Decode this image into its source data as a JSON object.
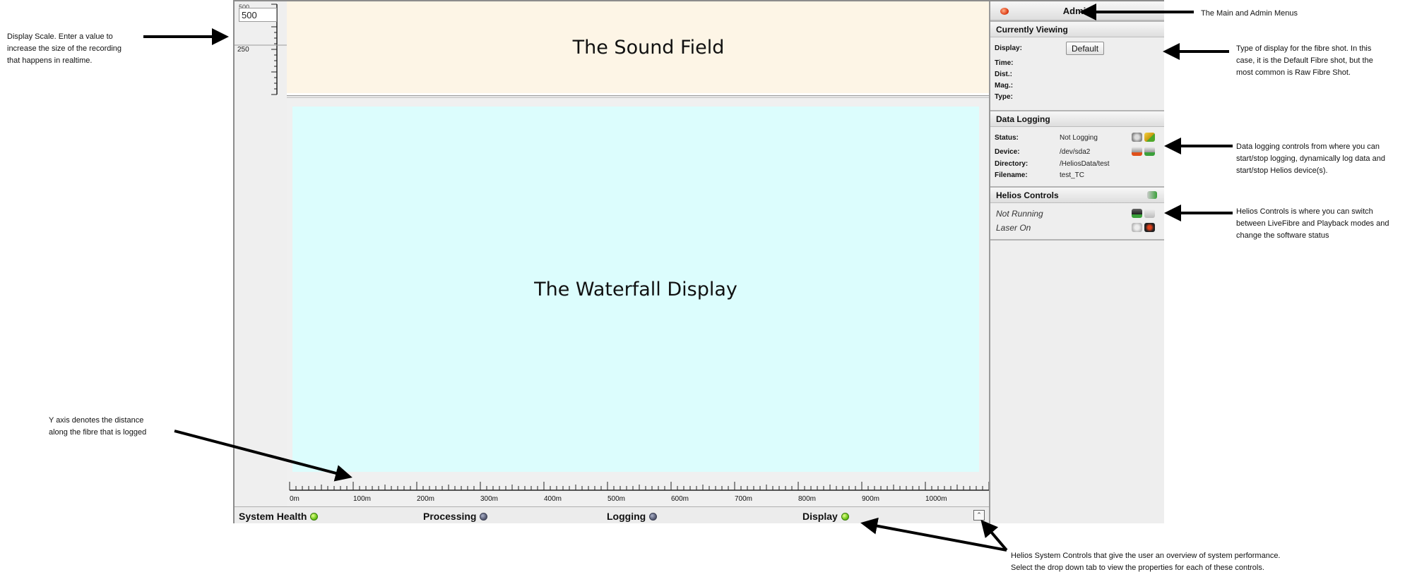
{
  "annotations": {
    "display_scale": [
      "Display Scale. Enter a value to",
      "increase the size of the recording",
      "that happens in realtime."
    ],
    "main_admin_menus": "The Main and Admin Menus",
    "display_type": [
      "Type of display for the fibre shot. In this",
      "case, it is the Default Fibre shot, but the",
      "most common is Raw Fibre Shot."
    ],
    "data_logging": [
      "Data logging controls from where you can",
      "start/stop logging, dynamically log data and",
      "start/stop Helios device(s)."
    ],
    "helios_controls": [
      "Helios Controls is where you can switch",
      "between LiveFibre and Playback modes and",
      "change the software status"
    ],
    "y_axis": [
      "Y axis denotes the distance",
      "along the fibre that is logged"
    ],
    "system_controls": [
      "Helios System Controls that give the user an overview of system performance.",
      "Select the drop down tab to view the properties for each of these controls."
    ]
  },
  "scale": {
    "input_value": "500",
    "top_label": "500",
    "mid_label": "250"
  },
  "sound_field": {
    "title": "The Sound Field"
  },
  "waterfall": {
    "title": "The Waterfall Display"
  },
  "xaxis": {
    "labels": [
      "0m",
      "100m",
      "200m",
      "300m",
      "400m",
      "500m",
      "600m",
      "700m",
      "800m",
      "900m",
      "1000m"
    ]
  },
  "statusbar": {
    "items": [
      {
        "label": "System Health",
        "state": "green"
      },
      {
        "label": "Processing",
        "state": "grey"
      },
      {
        "label": "Logging",
        "state": "grey"
      },
      {
        "label": "Display",
        "state": "green"
      }
    ],
    "expand_icon": "expand-tab-icon"
  },
  "panel": {
    "admin_label": "Admin",
    "currently_viewing": {
      "title": "Currently Viewing",
      "display_label": "Display:",
      "display_button": "Default",
      "time_label": "Time:",
      "dist_label": "Dist.:",
      "mag_label": "Mag.:",
      "type_label": "Type:"
    },
    "data_logging": {
      "title": "Data Logging",
      "status_label": "Status:",
      "status_value": "Not Logging",
      "device_label": "Device:",
      "device_value": "/dev/sda2",
      "directory_label": "Directory:",
      "directory_value": "/HeliosData/test",
      "filename_label": "Filename:",
      "filename_value": "test_TC"
    },
    "helios_controls": {
      "title": "Helios Controls",
      "running_status": "Not Running",
      "laser_status": "Laser On"
    }
  },
  "colors": {
    "sound_field_bg": "#fdf5e6",
    "waterfall_bg": "#dcfdfd",
    "status_green": "#6fc81a",
    "status_grey": "#5b6078"
  }
}
